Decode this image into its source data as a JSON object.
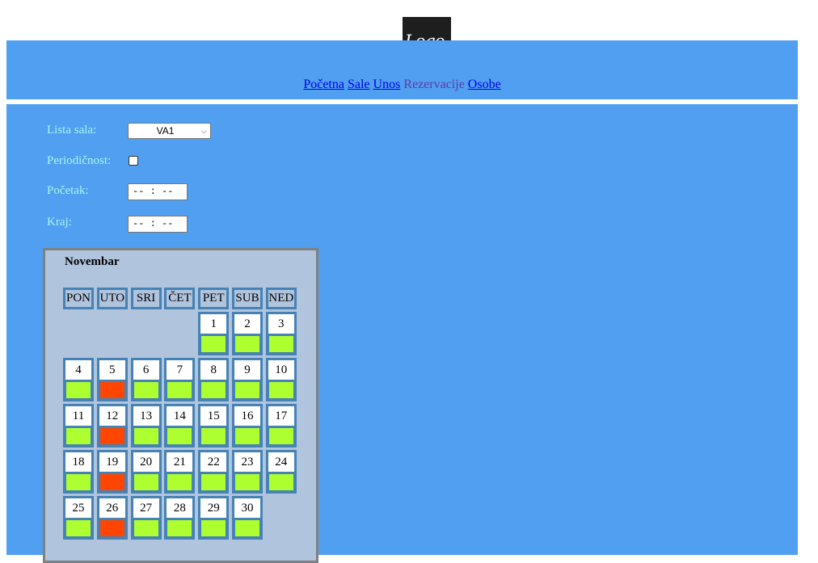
{
  "logo": {
    "text": "Logo",
    "dot": "."
  },
  "nav": {
    "links": [
      "Početna",
      "Sale",
      "Unos",
      "Rezervacije",
      "Osobe"
    ],
    "current": "Rezervacije"
  },
  "form": {
    "hall_label": "Lista sala:",
    "hall_value": "VA1",
    "periodic_label": "Periodičnost:",
    "periodic_checked": false,
    "start_label": "Početak:",
    "start_value": "-- : --",
    "end_label": "Kraj:",
    "end_value": "-- : --"
  },
  "calendar": {
    "month": "Novembar",
    "weekdays": [
      "PON",
      "UTO",
      "SRI",
      "ČET",
      "PET",
      "SUB",
      "NED"
    ],
    "first_weekday_index": 4,
    "days": [
      {
        "day": "1",
        "status": "free"
      },
      {
        "day": "2",
        "status": "free"
      },
      {
        "day": "3",
        "status": "free"
      },
      {
        "day": "4",
        "status": "free"
      },
      {
        "day": "5",
        "status": "reserved"
      },
      {
        "day": "6",
        "status": "free"
      },
      {
        "day": "7",
        "status": "free"
      },
      {
        "day": "8",
        "status": "free"
      },
      {
        "day": "9",
        "status": "free"
      },
      {
        "day": "10",
        "status": "free"
      },
      {
        "day": "11",
        "status": "free"
      },
      {
        "day": "12",
        "status": "reserved"
      },
      {
        "day": "13",
        "status": "free"
      },
      {
        "day": "14",
        "status": "free"
      },
      {
        "day": "15",
        "status": "free"
      },
      {
        "day": "16",
        "status": "free"
      },
      {
        "day": "17",
        "status": "free"
      },
      {
        "day": "18",
        "status": "free"
      },
      {
        "day": "19",
        "status": "reserved"
      },
      {
        "day": "20",
        "status": "free"
      },
      {
        "day": "21",
        "status": "free"
      },
      {
        "day": "22",
        "status": "free"
      },
      {
        "day": "23",
        "status": "free"
      },
      {
        "day": "24",
        "status": "free"
      },
      {
        "day": "25",
        "status": "free"
      },
      {
        "day": "26",
        "status": "reserved"
      },
      {
        "day": "27",
        "status": "free"
      },
      {
        "day": "28",
        "status": "free"
      },
      {
        "day": "29",
        "status": "free"
      },
      {
        "day": "30",
        "status": "free"
      }
    ],
    "colors": {
      "free": "#adff2f",
      "reserved": "#ff4500"
    }
  },
  "colors": {
    "panel": "#519ff0",
    "label": "#a8f5f5",
    "calendar_bg": "#b0c4de",
    "cell_border": "#4682b4"
  }
}
